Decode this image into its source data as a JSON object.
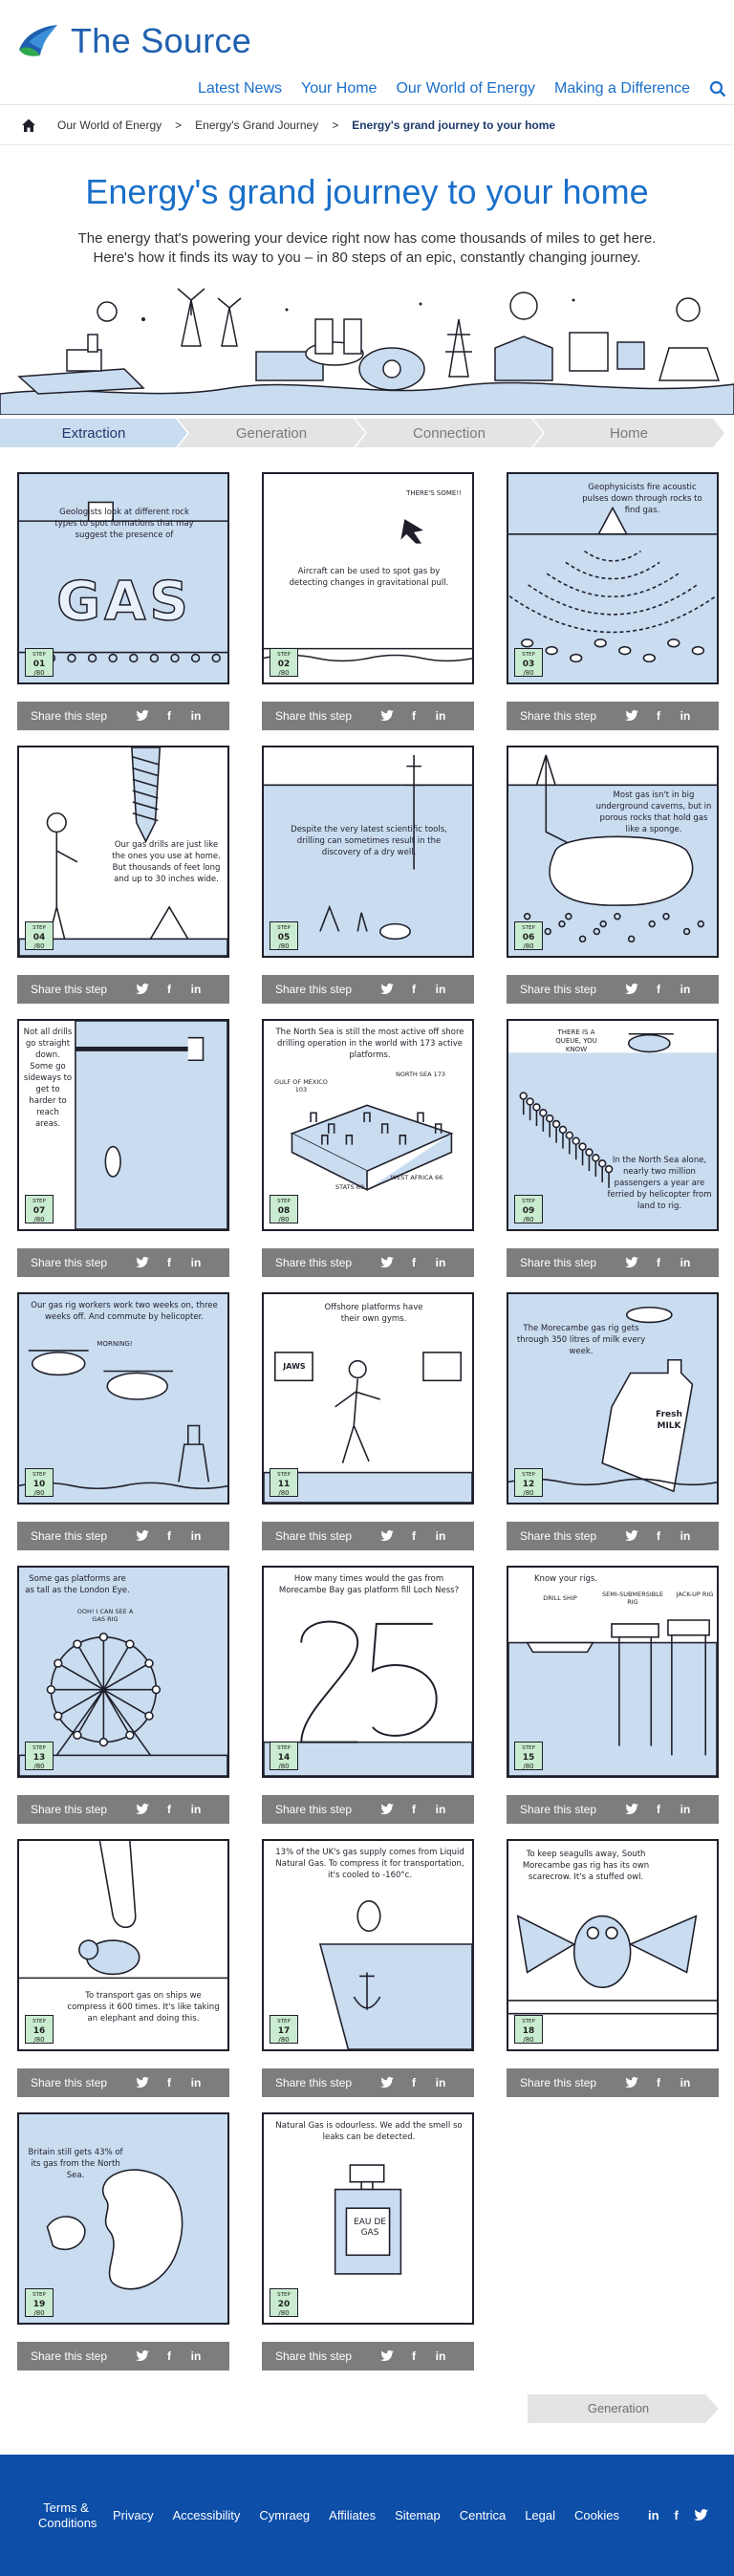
{
  "site": {
    "title": "The Source"
  },
  "nav": [
    {
      "label": "Latest News"
    },
    {
      "label": "Your Home"
    },
    {
      "label": "Our World of Energy"
    },
    {
      "label": "Making a Difference"
    }
  ],
  "breadcrumb": {
    "items": [
      "Our World of Energy",
      "Energy's Grand Journey"
    ],
    "current": "Energy's grand journey to your home"
  },
  "hero": {
    "title": "Energy's grand journey to your home",
    "subtitle_line1": "The energy that's powering your device right now has come thousands of miles to get here.",
    "subtitle_line2": "Here's how it finds its way to you – in 80 steps of an epic, constantly changing journey."
  },
  "stages": [
    {
      "label": "Extraction",
      "active": true
    },
    {
      "label": "Generation",
      "active": false
    },
    {
      "label": "Connection",
      "active": false
    },
    {
      "label": "Home",
      "active": false
    }
  ],
  "share": {
    "label": "Share this step",
    "icons": [
      "twitter-icon",
      "facebook-icon",
      "linkedin-icon"
    ]
  },
  "step_badge": {
    "label": "STEP",
    "total": "/80"
  },
  "cards": [
    {
      "num": "01",
      "text": "Geologists look at different rock types to spot formations that may suggest the presence of",
      "big": "GAS"
    },
    {
      "num": "02",
      "text": "Aircraft can be used to spot gas by detecting changes in gravitational pull.",
      "extra": "THERE'S SOME!!"
    },
    {
      "num": "03",
      "text": "Geophysicists fire acoustic pulses down through rocks to find gas."
    },
    {
      "num": "04",
      "text": "Our gas drills are just like the ones you use at home. But thousands of feet long and up to 30 inches wide."
    },
    {
      "num": "05",
      "text": "Despite the very latest scientific tools, drilling can sometimes result in the discovery of a dry well."
    },
    {
      "num": "06",
      "text": "Most gas isn't in big underground caverns, but in porous rocks that hold gas like a sponge."
    },
    {
      "num": "07",
      "text": "Not all drills go straight down. Some go sideways to get to harder to reach areas."
    },
    {
      "num": "08",
      "text": "The North Sea is still the most active off shore drilling operation in the world with 173 active platforms.",
      "labels": [
        "GULF OF MEXICO 103",
        "NORTH SEA 173",
        "STATS 69",
        "WEST AFRICA 66"
      ]
    },
    {
      "num": "09",
      "text": "In the North Sea alone, nearly two million passengers a year are ferried by helicopter from land to rig.",
      "extra": "THERE IS A QUEUE, YOU KNOW"
    },
    {
      "num": "10",
      "text": "Our gas rig workers work two weeks on, three weeks off. And commute by helicopter.",
      "extra": "MORNING!"
    },
    {
      "num": "11",
      "text": "Offshore platforms have their own gyms.",
      "extra": "JAWS"
    },
    {
      "num": "12",
      "text": "The Morecambe gas rig gets through 350 litres of milk every week.",
      "extra": "Fresh MILK"
    },
    {
      "num": "13",
      "text": "Some gas platforms are as tall as the London Eye.",
      "extra": "OOH! I CAN SEE A GAS RIG"
    },
    {
      "num": "14",
      "text": "How many times would the gas from Morecambe Bay gas platform fill Loch Ness?",
      "big": "25"
    },
    {
      "num": "15",
      "text": "Know your rigs.",
      "labels": [
        "DRILL SHIP",
        "SEMI-SUBMERSIBLE RIG",
        "JACK-UP RIG"
      ]
    },
    {
      "num": "16",
      "text": "To transport gas on ships we compress it 600 times. It's like taking an elephant and doing this."
    },
    {
      "num": "17",
      "text": "13% of the UK's gas supply comes from Liquid Natural Gas. To compress it for transportation, it's cooled to -160°c."
    },
    {
      "num": "18",
      "text": "To keep seagulls away, South Morecambe gas rig has its own scarecrow. It's a stuffed owl."
    },
    {
      "num": "19",
      "text": "Britain still gets 43% of its gas from the North Sea."
    },
    {
      "num": "20",
      "text": "Natural Gas is odourless. We add the smell so leaks can be detected.",
      "extra": "EAU DE GAS"
    }
  ],
  "next_stage": {
    "label": "Generation"
  },
  "footer": {
    "links": [
      "Terms & Conditions",
      "Privacy",
      "Accessibility",
      "Cymraeg",
      "Affiliates",
      "Sitemap",
      "Centrica",
      "Legal",
      "Cookies"
    ],
    "social": [
      "linkedin-icon",
      "facebook-icon",
      "twitter-icon"
    ]
  },
  "colors": {
    "brand_blue": "#1a6fc9",
    "footer_blue": "#0c4ea8",
    "panel_blue": "#c9dcf0",
    "share_grey": "#7d7d7d",
    "stage_active": "#c9dcf0"
  }
}
